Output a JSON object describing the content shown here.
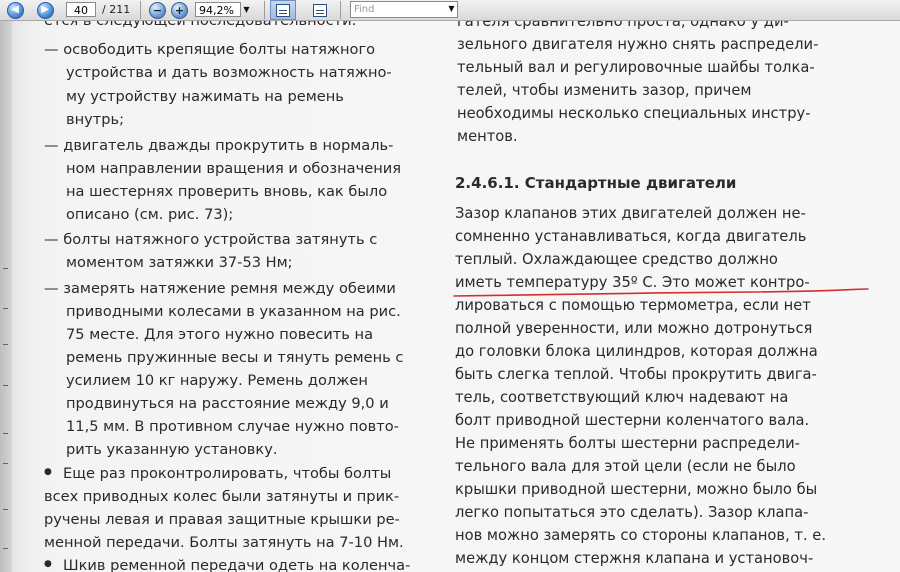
{
  "toolbar": {
    "page_current": "40",
    "page_total": "/ 211",
    "zoom_value": "94,2%",
    "find_placeholder": "Find",
    "prev_icon": "left-arrow-icon",
    "next_icon": "right-arrow-icon"
  },
  "document": {
    "left_column": [
      "ется в следующей последовательности:",
      "— освободить крепящие болты натяжного",
      "устройства и дать возможность натяжно-",
      "му устройству нажимать на ремень",
      "внутрь;",
      "— двигатель дважды прокрутить в нормаль-",
      "ном направлении вращения и обозначения",
      "на шестернях проверить вновь, как было",
      "описано (см. рис. 73);",
      "— болты натяжного устройства затянуть с",
      "моментом затяжки 37-53 Нм;",
      "— замерять натяжение ремня между обеими",
      "приводными колесами в указанном на рис.",
      "75 месте. Для этого нужно повесить на",
      "ремень пружинные весы и тянуть ремень с",
      "усилием 10 кг наружу. Ремень должен",
      "продвинуться на расстояние между 9,0 и",
      "11,5 мм. В противном случае нужно повто-",
      "рить указанную установку.",
      "Еще раз проконтролировать, чтобы болты",
      "всех приводных колес были затянуты и прик-",
      "ручены левая и правая защитные крышки ре-",
      "менной передачи. Болты затянуть на 7-10 Нм.",
      "Шкив ременной передачи одеть на коленча-"
    ],
    "right_column": [
      "гателя сравнительно проста, однако у ди-",
      "зельного двигателя нужно снять распредели-",
      "тельный вал и регулировочные шайбы толка-",
      "телей, чтобы изменить зазор, причем",
      "необходимы несколько специальных инстру-",
      "ментов.",
      "2.4.6.1. Стандартные двигатели",
      "Зазор клапанов этих двигателей должен не-",
      "сомненно устанавливаться, когда двигатель",
      "теплый. Охлаждающее средство должно",
      "иметь температуру 35º С. Это может контро-",
      "лироваться с помощью термометра, если нет",
      "полной уверенности, или можно дотронуться",
      "до головки блока цилиндров, которая должна",
      "быть слегка теплой. Чтобы прокрутить двига-",
      "тель, соответствующий ключ надевают на",
      "болт приводной шестерни коленчатого вала.",
      "Не применять болты шестерни распредели-",
      "тельного вала для этой цели (если не было",
      "крышки приводной шестерни, можно было бы",
      "легко попытаться это сделать). Зазор клапа-",
      "нов можно замерять со стороны клапанов, т. е.",
      "между концом стержня клапана и установоч-"
    ],
    "underline_color": "#d22f2f"
  }
}
